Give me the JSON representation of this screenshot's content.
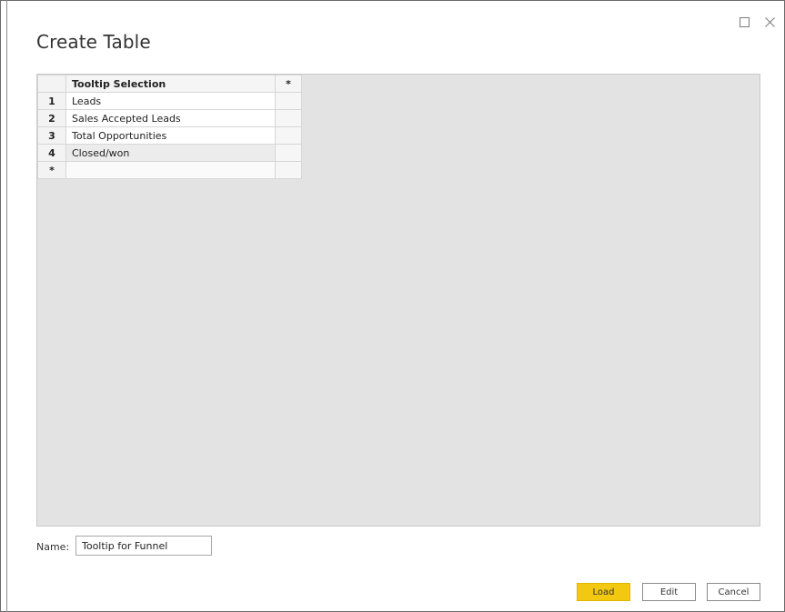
{
  "dialog": {
    "title": "Create Table",
    "maximize_icon": "maximize-icon",
    "close_icon": "close-icon"
  },
  "grid": {
    "column_header": "Tooltip Selection",
    "new_column_marker": "*",
    "rows": [
      {
        "num": "1",
        "value": "Leads"
      },
      {
        "num": "2",
        "value": "Sales Accepted Leads"
      },
      {
        "num": "3",
        "value": "Total Opportunities"
      },
      {
        "num": "4",
        "value": "Closed/won"
      }
    ],
    "new_row_marker": "*"
  },
  "name_field": {
    "label": "Name:",
    "value": "Tooltip for Funnel"
  },
  "buttons": {
    "load": "Load",
    "edit": "Edit",
    "cancel": "Cancel"
  },
  "colors": {
    "load_accent": "#f2c811",
    "grid_background": "#e3e3e3"
  }
}
